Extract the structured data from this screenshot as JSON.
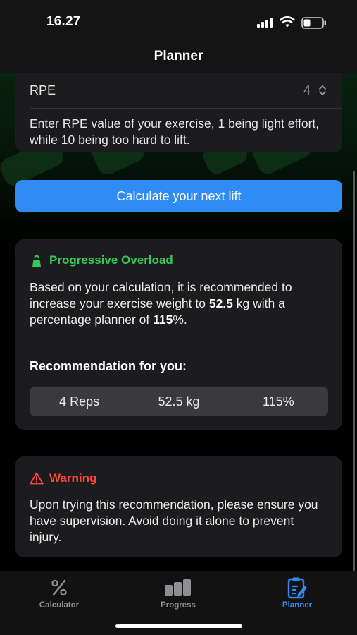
{
  "status_bar": {
    "time": "16.27"
  },
  "nav": {
    "title": "Planner"
  },
  "rpe": {
    "label": "RPE",
    "value": "4",
    "description": "Enter RPE value of your exercise, 1 being light effort, while 10 being too hard to lift."
  },
  "calculate_button": {
    "label": "Calculate your next lift"
  },
  "overload": {
    "title": "Progressive Overload",
    "text_part1": "Based on your calculation, it is recommended to increase your exercise weight to ",
    "weight": "52.5",
    "text_part2": " kg with a percentage planner of ",
    "percentage": "115",
    "text_part3": "%.",
    "recommendation_title": "Recommendation for you:",
    "recommendation": {
      "reps": "4 Reps",
      "weight": "52.5 kg",
      "percentage": "115%"
    }
  },
  "warning": {
    "title": "Warning",
    "text": "Upon trying this recommendation, please ensure you have supervision. Avoid doing it alone to prevent injury."
  },
  "tabs": [
    {
      "label": "Calculator",
      "icon": "percent-icon",
      "active": false
    },
    {
      "label": "Progress",
      "icon": "bar-chart-icon",
      "active": false
    },
    {
      "label": "Planner",
      "icon": "clipboard-edit-icon",
      "active": true
    }
  ],
  "colors": {
    "accent": "#2f8cf5",
    "success": "#34c759",
    "danger": "#ff453a",
    "card": "#1c1c1e"
  }
}
